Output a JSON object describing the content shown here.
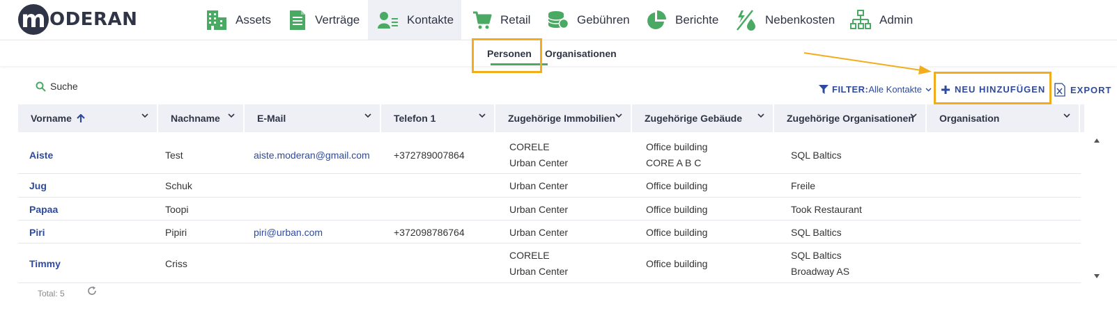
{
  "logo": {
    "letter": "m",
    "text": "ODERAN"
  },
  "nav": [
    {
      "label": "Assets",
      "icon": "building-icon"
    },
    {
      "label": "Verträge",
      "icon": "document-icon"
    },
    {
      "label": "Kontakte",
      "icon": "contact-icon",
      "active": true
    },
    {
      "label": "Retail",
      "icon": "cart-icon"
    },
    {
      "label": "Gebühren",
      "icon": "coins-icon"
    },
    {
      "label": "Berichte",
      "icon": "pie-chart-icon"
    },
    {
      "label": "Nebenkosten",
      "icon": "utilities-icon"
    },
    {
      "label": "Admin",
      "icon": "org-chart-icon"
    }
  ],
  "subtabs": {
    "personen": "Personen",
    "organisationen": "Organisationen",
    "active": "Personen"
  },
  "toolbar": {
    "search": "Suche",
    "filter_label": "FILTER:",
    "filter_value": "Alle Kontakte",
    "new_button": "NEU HINZUFÜGEN",
    "export": "EXPORT"
  },
  "columns": [
    "Vorname",
    "Nachname",
    "E-Mail",
    "Telefon 1",
    "Zugehörige Immobilien",
    "Zugehörige Gebäude",
    "Zugehörige Organisationen",
    "Organisation"
  ],
  "sort": {
    "column": "Vorname",
    "direction": "ascending"
  },
  "rows": [
    {
      "vorname": "Aiste",
      "nachname": "Test",
      "email": "aiste.moderan@gmail.com",
      "telefon": "+372789007864",
      "immobilien": [
        "CORELE",
        "Urban Center"
      ],
      "gebaeude": [
        "Office building",
        "CORE A B C"
      ],
      "organisationen": [
        "SQL Baltics"
      ],
      "organisation": ""
    },
    {
      "vorname": "Jug",
      "nachname": "Schuk",
      "email": "",
      "telefon": "",
      "immobilien": [
        "Urban Center"
      ],
      "gebaeude": [
        "Office building"
      ],
      "organisationen": [
        "Freile"
      ],
      "organisation": ""
    },
    {
      "vorname": "Papaa",
      "nachname": "Toopi",
      "email": "",
      "telefon": "",
      "immobilien": [
        "Urban Center"
      ],
      "gebaeude": [
        "Office building"
      ],
      "organisationen": [
        "Took Restaurant"
      ],
      "organisation": ""
    },
    {
      "vorname": "Piri",
      "nachname": "Pipiri",
      "email": "piri@urban.com",
      "telefon": "+372098786764",
      "immobilien": [
        "Urban Center"
      ],
      "gebaeude": [
        "Office building"
      ],
      "organisationen": [
        "SQL Baltics"
      ],
      "organisation": ""
    },
    {
      "vorname": "Timmy",
      "nachname": "Criss",
      "email": "",
      "telefon": "",
      "immobilien": [
        "CORELE",
        "Urban Center"
      ],
      "gebaeude": [
        "Office building"
      ],
      "organisationen": [
        "SQL Baltics",
        "Broadway AS"
      ],
      "organisation": ""
    }
  ],
  "footer": {
    "total": "Total: 5"
  },
  "colors": {
    "brand_dark": "#2f3546",
    "accent_green": "#4aaa63",
    "link_blue": "#2d4a9e",
    "highlight": "#f2ad1d",
    "header_bg": "#eef0f5"
  }
}
